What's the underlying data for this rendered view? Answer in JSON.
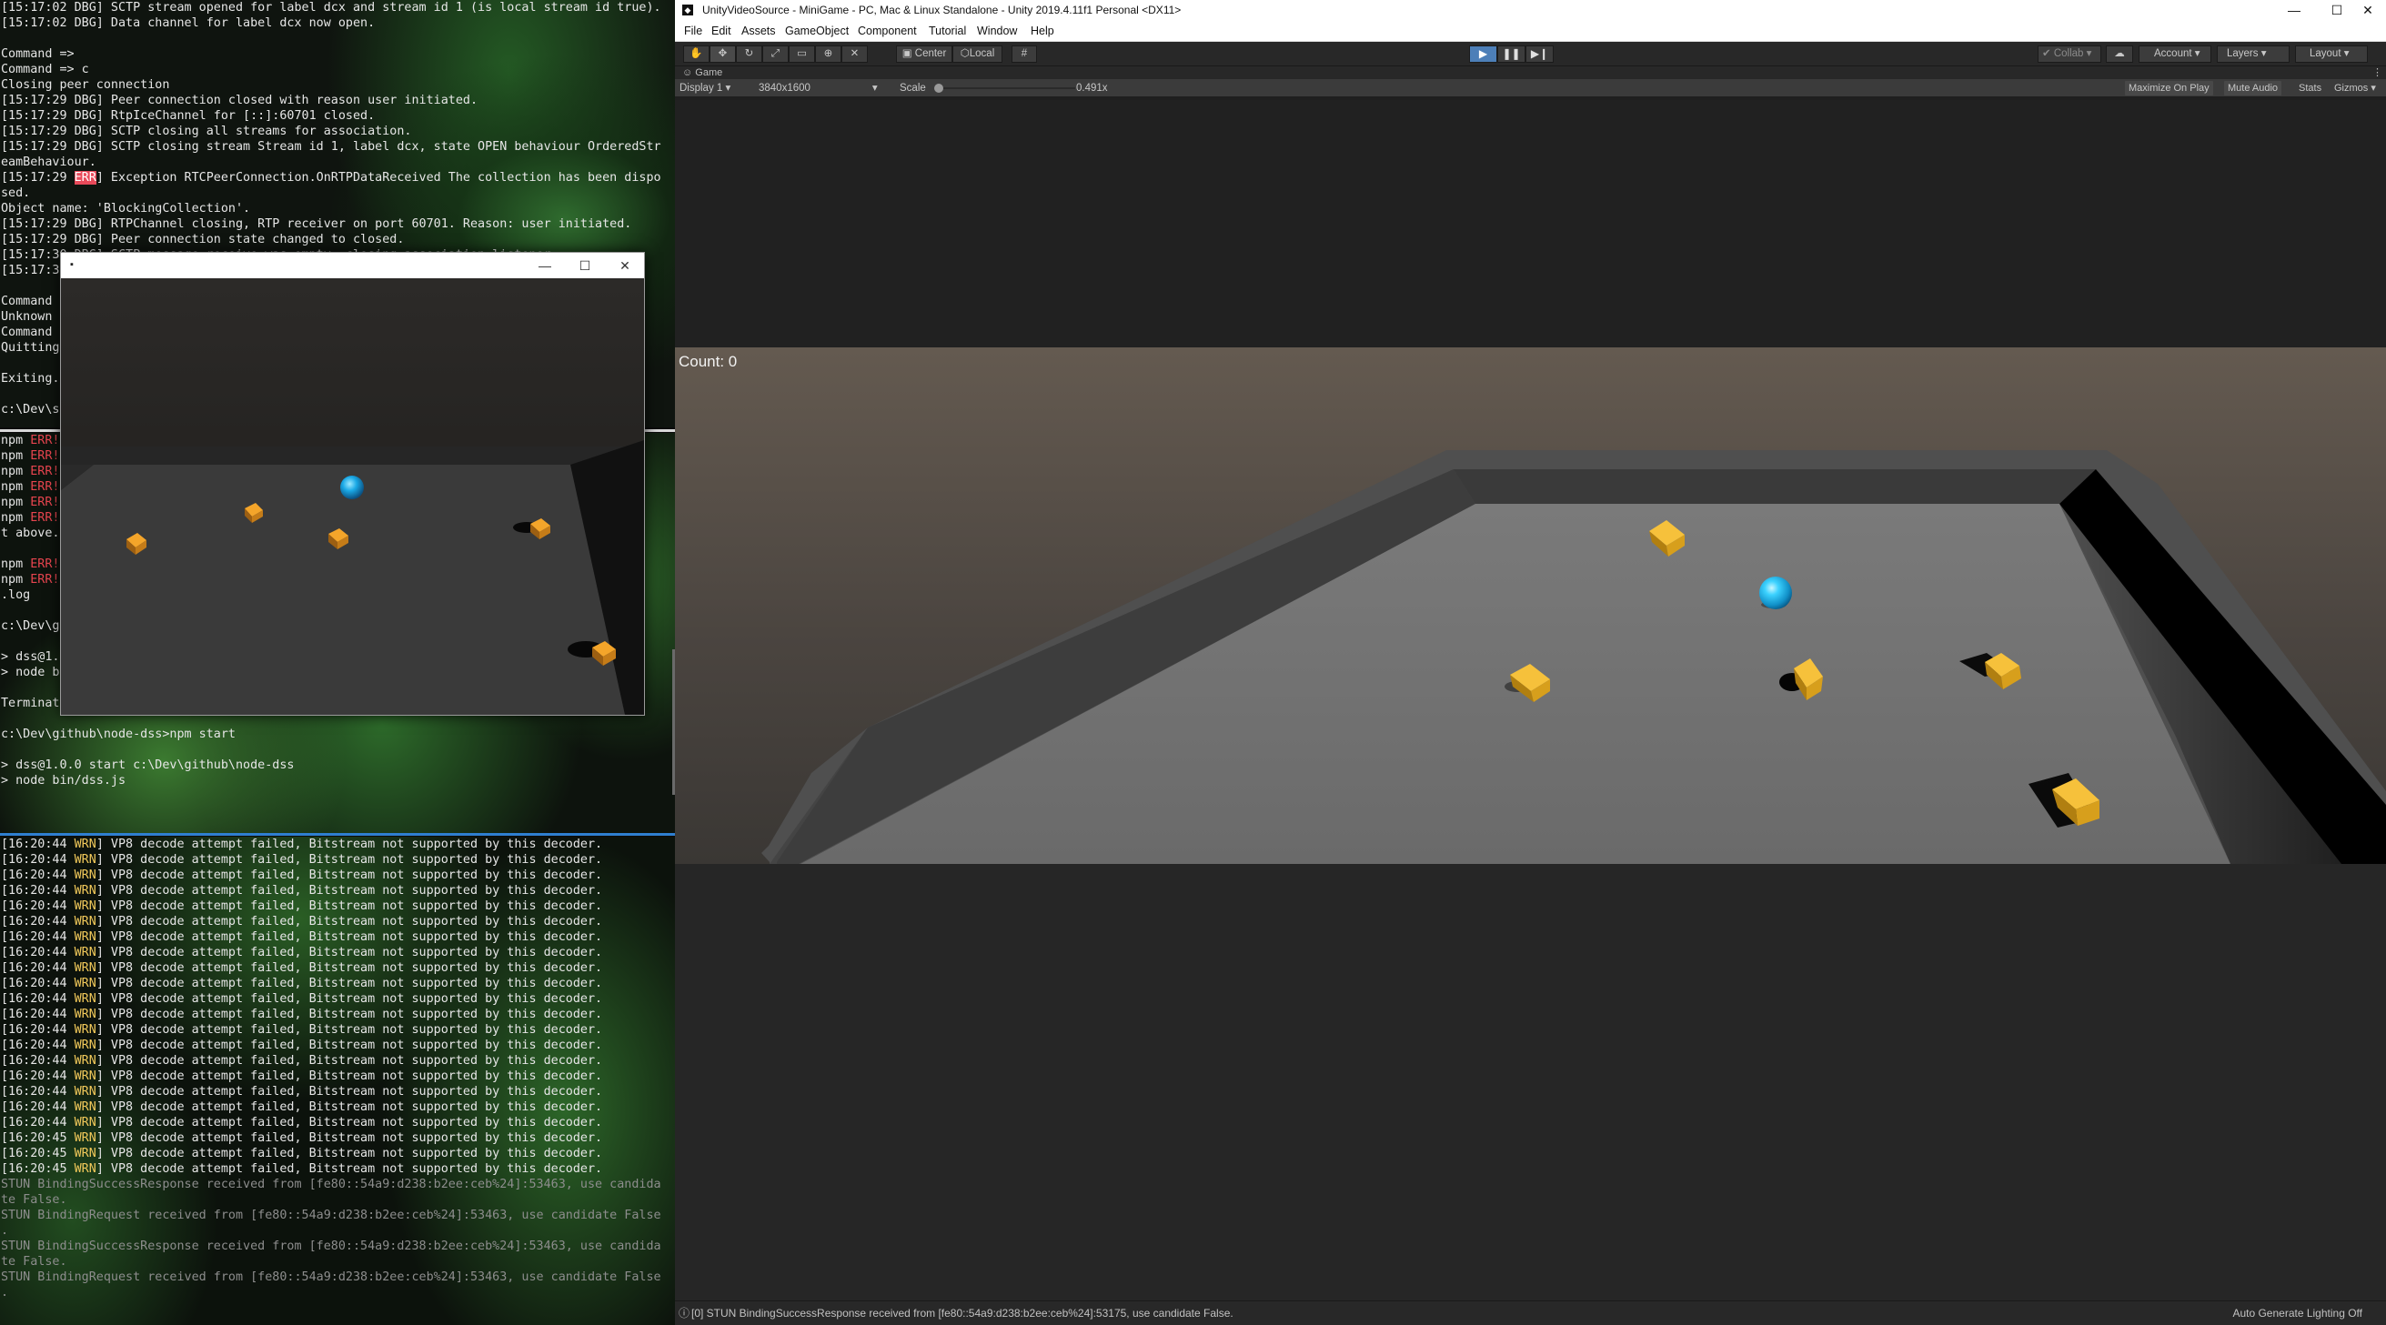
{
  "terminal_top": {
    "lines": [
      [
        {
          "t": "[15:17:02 DBG] SCTP stream opened for label dcx and stream id 1 (is local stream id true).",
          "c": "dbg"
        }
      ],
      [
        {
          "t": "[15:17:02 DBG] Data channel for label dcx now open.",
          "c": "dbg"
        }
      ],
      [
        {
          "t": "",
          "c": "dbg"
        }
      ],
      [
        {
          "t": "Command =>",
          "c": "dbg"
        }
      ],
      [
        {
          "t": "Command => c",
          "c": "dbg"
        }
      ],
      [
        {
          "t": "Closing peer connection",
          "c": "dbg"
        }
      ],
      [
        {
          "t": "[15:17:29 DBG] Peer connection closed with reason user initiated.",
          "c": "dbg"
        }
      ],
      [
        {
          "t": "[15:17:29 DBG] RtpIceChannel for [::]:60701 closed.",
          "c": "dbg"
        }
      ],
      [
        {
          "t": "[15:17:29 DBG] SCTP closing all streams for association.",
          "c": "dbg"
        }
      ],
      [
        {
          "t": "[15:17:29 DBG] SCTP closing stream Stream id 1, label dcx, state OPEN behaviour OrderedStr",
          "c": "dbg"
        }
      ],
      [
        {
          "t": "eamBehaviour.",
          "c": "dbg"
        }
      ],
      [
        {
          "t": "[15:17:29 ",
          "c": "dbg"
        },
        {
          "t": "ERR",
          "c": "err-hl"
        },
        {
          "t": "] Exception RTCPeerConnection.OnRTPDataReceived The collection has been dispo",
          "c": "dbg"
        }
      ],
      [
        {
          "t": "sed.",
          "c": "dbg"
        }
      ],
      [
        {
          "t": "Object name: 'BlockingCollection'.",
          "c": "dbg"
        }
      ],
      [
        {
          "t": "[15:17:29 DBG] RTPChannel closing, RTP receiver on port 60701. Reason: user initiated.",
          "c": "dbg"
        }
      ],
      [
        {
          "t": "[15:17:29 DBG] Peer connection state changed to closed.",
          "c": "dbg"
        }
      ],
      [
        {
          "t": "[15:17:30 DBG] SCTP message receive was empty, closing association listener.",
          "c": "dbg"
        }
      ],
      [
        {
          "t": "[15:17:3",
          "c": "dbg"
        }
      ],
      [
        {
          "t": "",
          "c": "dbg"
        }
      ],
      [
        {
          "t": "Command ",
          "c": "dbg"
        }
      ],
      [
        {
          "t": "Unknown ",
          "c": "dbg"
        }
      ],
      [
        {
          "t": "Command ",
          "c": "dbg"
        }
      ],
      [
        {
          "t": "Quitting",
          "c": "dbg"
        }
      ],
      [
        {
          "t": "",
          "c": "dbg"
        }
      ],
      [
        {
          "t": "Exiting.",
          "c": "dbg"
        }
      ],
      [
        {
          "t": "",
          "c": "dbg"
        }
      ],
      [
        {
          "t": "c:\\Dev\\s",
          "c": "dbg"
        }
      ]
    ]
  },
  "terminal_mid": {
    "lines": [
      [
        {
          "t": "npm ",
          "c": "dbg"
        },
        {
          "t": "ERR!",
          "c": "err"
        }
      ],
      [
        {
          "t": "npm ",
          "c": "dbg"
        },
        {
          "t": "ERR!",
          "c": "err"
        }
      ],
      [
        {
          "t": "npm ",
          "c": "dbg"
        },
        {
          "t": "ERR!",
          "c": "err"
        }
      ],
      [
        {
          "t": "npm ",
          "c": "dbg"
        },
        {
          "t": "ERR!",
          "c": "err"
        }
      ],
      [
        {
          "t": "npm ",
          "c": "dbg"
        },
        {
          "t": "ERR!",
          "c": "err"
        }
      ],
      [
        {
          "t": "npm ",
          "c": "dbg"
        },
        {
          "t": "ERR!",
          "c": "err"
        },
        {
          "t": "                                                                              u",
          "c": "dbg"
        }
      ],
      [
        {
          "t": "t above.",
          "c": "dbg"
        }
      ],
      [
        {
          "t": "",
          "c": "dbg"
        }
      ],
      [
        {
          "t": "npm ",
          "c": "dbg"
        },
        {
          "t": "ERR!",
          "c": "err"
        }
      ],
      [
        {
          "t": "npm ",
          "c": "dbg"
        },
        {
          "t": "ERR!",
          "c": "err"
        },
        {
          "t": "                                                                              g",
          "c": "dbg"
        }
      ],
      [
        {
          "t": ".log",
          "c": "dbg"
        }
      ],
      [
        {
          "t": "",
          "c": "dbg"
        }
      ],
      [
        {
          "t": "c:\\Dev\\g",
          "c": "dbg"
        }
      ],
      [
        {
          "t": "",
          "c": "dbg"
        }
      ],
      [
        {
          "t": "> dss@1.0",
          "c": "dbg"
        }
      ],
      [
        {
          "t": "> node b",
          "c": "dbg"
        }
      ],
      [
        {
          "t": "",
          "c": "dbg"
        }
      ],
      [
        {
          "t": "Terminat",
          "c": "dbg"
        }
      ],
      [
        {
          "t": "",
          "c": "dbg"
        }
      ],
      [
        {
          "t": "c:\\Dev\\github\\node-dss>npm start",
          "c": "dbg"
        }
      ],
      [
        {
          "t": "",
          "c": "dbg"
        }
      ],
      [
        {
          "t": "> dss@1.0.0 start c:\\Dev\\github\\node-dss",
          "c": "dbg"
        }
      ],
      [
        {
          "t": "> node bin/dss.js",
          "c": "dbg"
        }
      ]
    ]
  },
  "terminal_bottom": {
    "lines": [
      [
        {
          "t": "[16:20:44 ",
          "c": "dbg"
        },
        {
          "t": "WRN",
          "c": "wrn"
        },
        {
          "t": "] VP8 decode attempt failed, Bitstream not supported by this decoder.",
          "c": "dbg"
        }
      ],
      [
        {
          "t": "[16:20:44 ",
          "c": "dbg"
        },
        {
          "t": "WRN",
          "c": "wrn"
        },
        {
          "t": "] VP8 decode attempt failed, Bitstream not supported by this decoder.",
          "c": "dbg"
        }
      ],
      [
        {
          "t": "[16:20:44 ",
          "c": "dbg"
        },
        {
          "t": "WRN",
          "c": "wrn"
        },
        {
          "t": "] VP8 decode attempt failed, Bitstream not supported by this decoder.",
          "c": "dbg"
        }
      ],
      [
        {
          "t": "[16:20:44 ",
          "c": "dbg"
        },
        {
          "t": "WRN",
          "c": "wrn"
        },
        {
          "t": "] VP8 decode attempt failed, Bitstream not supported by this decoder.",
          "c": "dbg"
        }
      ],
      [
        {
          "t": "[16:20:44 ",
          "c": "dbg"
        },
        {
          "t": "WRN",
          "c": "wrn"
        },
        {
          "t": "] VP8 decode attempt failed, Bitstream not supported by this decoder.",
          "c": "dbg"
        }
      ],
      [
        {
          "t": "[16:20:44 ",
          "c": "dbg"
        },
        {
          "t": "WRN",
          "c": "wrn"
        },
        {
          "t": "] VP8 decode attempt failed, Bitstream not supported by this decoder.",
          "c": "dbg"
        }
      ],
      [
        {
          "t": "[16:20:44 ",
          "c": "dbg"
        },
        {
          "t": "WRN",
          "c": "wrn"
        },
        {
          "t": "] VP8 decode attempt failed, Bitstream not supported by this decoder.",
          "c": "dbg"
        }
      ],
      [
        {
          "t": "[16:20:44 ",
          "c": "dbg"
        },
        {
          "t": "WRN",
          "c": "wrn"
        },
        {
          "t": "] VP8 decode attempt failed, Bitstream not supported by this decoder.",
          "c": "dbg"
        }
      ],
      [
        {
          "t": "[16:20:44 ",
          "c": "dbg"
        },
        {
          "t": "WRN",
          "c": "wrn"
        },
        {
          "t": "] VP8 decode attempt failed, Bitstream not supported by this decoder.",
          "c": "dbg"
        }
      ],
      [
        {
          "t": "[16:20:44 ",
          "c": "dbg"
        },
        {
          "t": "WRN",
          "c": "wrn"
        },
        {
          "t": "] VP8 decode attempt failed, Bitstream not supported by this decoder.",
          "c": "dbg"
        }
      ],
      [
        {
          "t": "[16:20:44 ",
          "c": "dbg"
        },
        {
          "t": "WRN",
          "c": "wrn"
        },
        {
          "t": "] VP8 decode attempt failed, Bitstream not supported by this decoder.",
          "c": "dbg"
        }
      ],
      [
        {
          "t": "[16:20:44 ",
          "c": "dbg"
        },
        {
          "t": "WRN",
          "c": "wrn"
        },
        {
          "t": "] VP8 decode attempt failed, Bitstream not supported by this decoder.",
          "c": "dbg"
        }
      ],
      [
        {
          "t": "[16:20:44 ",
          "c": "dbg"
        },
        {
          "t": "WRN",
          "c": "wrn"
        },
        {
          "t": "] VP8 decode attempt failed, Bitstream not supported by this decoder.",
          "c": "dbg"
        }
      ],
      [
        {
          "t": "[16:20:44 ",
          "c": "dbg"
        },
        {
          "t": "WRN",
          "c": "wrn"
        },
        {
          "t": "] VP8 decode attempt failed, Bitstream not supported by this decoder.",
          "c": "dbg"
        }
      ],
      [
        {
          "t": "[16:20:44 ",
          "c": "dbg"
        },
        {
          "t": "WRN",
          "c": "wrn"
        },
        {
          "t": "] VP8 decode attempt failed, Bitstream not supported by this decoder.",
          "c": "dbg"
        }
      ],
      [
        {
          "t": "[16:20:44 ",
          "c": "dbg"
        },
        {
          "t": "WRN",
          "c": "wrn"
        },
        {
          "t": "] VP8 decode attempt failed, Bitstream not supported by this decoder.",
          "c": "dbg"
        }
      ],
      [
        {
          "t": "[16:20:44 ",
          "c": "dbg"
        },
        {
          "t": "WRN",
          "c": "wrn"
        },
        {
          "t": "] VP8 decode attempt failed, Bitstream not supported by this decoder.",
          "c": "dbg"
        }
      ],
      [
        {
          "t": "[16:20:44 ",
          "c": "dbg"
        },
        {
          "t": "WRN",
          "c": "wrn"
        },
        {
          "t": "] VP8 decode attempt failed, Bitstream not supported by this decoder.",
          "c": "dbg"
        }
      ],
      [
        {
          "t": "[16:20:44 ",
          "c": "dbg"
        },
        {
          "t": "WRN",
          "c": "wrn"
        },
        {
          "t": "] VP8 decode attempt failed, Bitstream not supported by this decoder.",
          "c": "dbg"
        }
      ],
      [
        {
          "t": "[16:20:45 ",
          "c": "dbg"
        },
        {
          "t": "WRN",
          "c": "wrn"
        },
        {
          "t": "] VP8 decode attempt failed, Bitstream not supported by this decoder.",
          "c": "dbg"
        }
      ],
      [
        {
          "t": "[16:20:45 ",
          "c": "dbg"
        },
        {
          "t": "WRN",
          "c": "wrn"
        },
        {
          "t": "] VP8 decode attempt failed, Bitstream not supported by this decoder.",
          "c": "dbg"
        }
      ],
      [
        {
          "t": "[16:20:45 ",
          "c": "dbg"
        },
        {
          "t": "WRN",
          "c": "wrn"
        },
        {
          "t": "] VP8 decode attempt failed, Bitstream not supported by this decoder.",
          "c": "dbg"
        }
      ],
      [
        {
          "t": "STUN BindingSuccessResponse received from [fe80::54a9:d238:b2ee:ceb%24]:53463, use candida",
          "c": "gray"
        }
      ],
      [
        {
          "t": "te False.",
          "c": "gray"
        }
      ],
      [
        {
          "t": "STUN BindingRequest received from [fe80::54a9:d238:b2ee:ceb%24]:53463, use candidate False",
          "c": "gray"
        }
      ],
      [
        {
          "t": ".",
          "c": "gray"
        }
      ],
      [
        {
          "t": "STUN BindingSuccessResponse received from [fe80::54a9:d238:b2ee:ceb%24]:53463, use candida",
          "c": "gray"
        }
      ],
      [
        {
          "t": "te False.",
          "c": "gray"
        }
      ],
      [
        {
          "t": "STUN BindingRequest received from [fe80::54a9:d238:b2ee:ceb%24]:53463, use candidate False",
          "c": "gray"
        }
      ],
      [
        {
          "t": ".",
          "c": "gray"
        }
      ]
    ]
  },
  "player_window": {
    "minimize": "—",
    "maximize": "☐",
    "close": "✕"
  },
  "unity": {
    "title": "UnityVideoSource - MiniGame - PC, Mac & Linux Standalone - Unity 2019.4.11f1 Personal <DX11>",
    "window_buttons": {
      "minimize": "—",
      "maximize": "☐",
      "close": "✕"
    },
    "menu": [
      "File",
      "Edit",
      "Assets",
      "GameObject",
      "Component",
      "Tutorial",
      "Window",
      "Help"
    ],
    "toolbar": {
      "pivot": "Center",
      "space": "Local",
      "collab": "Collab",
      "account": "Account",
      "layers": "Layers",
      "layout": "Layout"
    },
    "tab": "Game",
    "gamebar": {
      "display": "Display 1",
      "resolution": "3840x1600",
      "scale_label": "Scale",
      "scale_value": "0.491x",
      "maximize_on_play": "Maximize On Play",
      "mute_audio": "Mute Audio",
      "stats": "Stats",
      "gizmos": "Gizmos"
    },
    "count_text": "Count: 0",
    "status_message": "[0] STUN BindingSuccessResponse received from [fe80::54a9:d238:b2ee:ceb%24]:53175, use candidate False.",
    "status_right": "Auto Generate Lighting Off"
  },
  "colors": {
    "ball": "#16c6ff",
    "cube": "#f2b31c",
    "play_active": "#4d7fb8",
    "err_highlight": "#e84a5a",
    "warn": "#f0c85a"
  }
}
